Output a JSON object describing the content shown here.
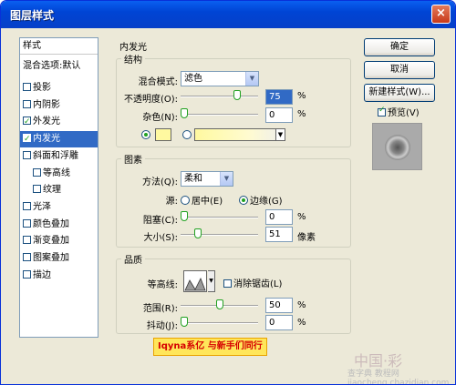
{
  "window": {
    "title": "图层样式",
    "close": "×"
  },
  "sidebar": {
    "header": "样式",
    "blending": "混合选项:默认",
    "items": [
      {
        "label": "投影",
        "checked": false
      },
      {
        "label": "内阴影",
        "checked": false
      },
      {
        "label": "外发光",
        "checked": true
      },
      {
        "label": "内发光",
        "checked": true,
        "selected": true
      },
      {
        "label": "斜面和浮雕",
        "checked": false
      },
      {
        "label": "等高线",
        "checked": false,
        "indent": true
      },
      {
        "label": "纹理",
        "checked": false,
        "indent": true
      },
      {
        "label": "光泽",
        "checked": false
      },
      {
        "label": "颜色叠加",
        "checked": false
      },
      {
        "label": "渐变叠加",
        "checked": false
      },
      {
        "label": "图案叠加",
        "checked": false
      },
      {
        "label": "描边",
        "checked": false
      }
    ]
  },
  "panel": {
    "title": "内发光",
    "structure": {
      "legend": "结构",
      "blend_label": "混合模式:",
      "blend_value": "滤色",
      "opacity_label": "不透明度(O):",
      "opacity_value": "75",
      "opacity_unit": "%",
      "opacity_level": 0.75,
      "noise_label": "杂色(N):",
      "noise_value": "0",
      "noise_unit": "%",
      "noise_level": 0,
      "color_swatch": "#fff9a0"
    },
    "elements": {
      "legend": "图素",
      "method_label": "方法(Q):",
      "method_value": "柔和",
      "source_label": "源:",
      "source_center": "居中(E)",
      "source_edge": "边缘(G)",
      "source_selected": "edge",
      "choke_label": "阻塞(C):",
      "choke_value": "0",
      "choke_unit": "%",
      "choke_level": 0,
      "size_label": "大小(S):",
      "size_value": "51",
      "size_unit": "像素",
      "size_level": 0.2
    },
    "quality": {
      "legend": "品质",
      "contour_label": "等高线:",
      "antialias_label": "消除锯齿(L)",
      "antialias_checked": false,
      "range_label": "范围(R):",
      "range_value": "50",
      "range_unit": "%",
      "range_level": 0.5,
      "jitter_label": "抖动(J):",
      "jitter_value": "0",
      "jitter_unit": "%",
      "jitter_level": 0
    }
  },
  "buttons": {
    "ok": "确定",
    "cancel": "取消",
    "new_style": "新建样式(W)...",
    "preview_label": "预览(V)",
    "preview_checked": true
  },
  "watermark": {
    "badge": "Iqyna系亿 与新手们同行",
    "site": "查字典 教程网 jiaocheng.chazidian.com",
    "logo": "中国·彩"
  }
}
